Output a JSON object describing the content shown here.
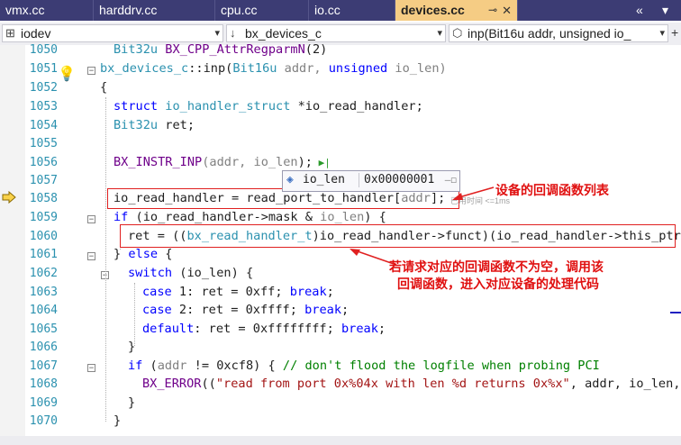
{
  "tabs": [
    {
      "label": "vmx.cc",
      "active": false
    },
    {
      "label": "harddrv.cc",
      "active": false
    },
    {
      "label": "cpu.cc",
      "active": false
    },
    {
      "label": "io.cc",
      "active": false
    },
    {
      "label": "devices.cc",
      "active": true
    }
  ],
  "tab_pin_glyph": "⊸",
  "tab_close_glyph": "✕",
  "tab_controls": {
    "overflow": "«",
    "menu": "▾"
  },
  "nav": {
    "project": "iodev",
    "scope": "bx_devices_c",
    "member": "inp(Bit16u addr, unsigned io_"
  },
  "lines": [
    {
      "n": "1050"
    },
    {
      "n": "1051"
    },
    {
      "n": "1052"
    },
    {
      "n": "1053"
    },
    {
      "n": "1054"
    },
    {
      "n": "1055"
    },
    {
      "n": "1056"
    },
    {
      "n": "1057"
    },
    {
      "n": "1058"
    },
    {
      "n": "1059"
    },
    {
      "n": "1060"
    },
    {
      "n": "1061"
    },
    {
      "n": "1062"
    },
    {
      "n": "1063"
    },
    {
      "n": "1064"
    },
    {
      "n": "1065"
    },
    {
      "n": "1066"
    },
    {
      "n": "1067"
    },
    {
      "n": "1068"
    },
    {
      "n": "1069"
    },
    {
      "n": "1070"
    }
  ],
  "code": {
    "l1050": {
      "ty": "Bit32u",
      "mac": "BX_CPP_AttrRegparmN",
      "rest": "(2)"
    },
    "l1051": {
      "cls": "bx_devices_c",
      "sep": "::",
      "fn": "inp(",
      "t1": "Bit16u",
      "p1": " addr, ",
      "kw": "unsigned",
      "p2": " io_len)"
    },
    "l1052": "{",
    "l1053": {
      "kw": "struct",
      "ty": " io_handler_struct",
      "rest": " *io_read_handler;"
    },
    "l1054": {
      "ty": "Bit32u",
      "rest": " ret;"
    },
    "l1056": {
      "mac": "BX_INSTR_INP",
      "a": "(addr, ",
      "b": "io_len",
      "c": ");",
      "run": " ▶|"
    },
    "l1058": {
      "a": "io_read_handler = read_port_to_handler[",
      "b": "addr",
      "c": "];"
    },
    "l1059": {
      "kw": "if",
      "a": " (io_read_handler->mask & ",
      "b": "io_len",
      "c": ") {"
    },
    "l1060": {
      "a": "ret = ((",
      "ty": "bx_read_handler_t",
      "b": ")io_read_handler->funct)(io_read_handler->this_ptr"
    },
    "l1061": {
      "a": "} ",
      "kw": "else",
      "b": " {"
    },
    "l1062": {
      "kw": "switch",
      "a": " (io_len) {"
    },
    "l1063": {
      "kw": "case",
      "a": " 1: ret = 0xff; ",
      "kw2": "break",
      "b": ";"
    },
    "l1064": {
      "kw": "case",
      "a": " 2: ret = 0xffff; ",
      "kw2": "break",
      "b": ";"
    },
    "l1065": {
      "kw": "default",
      "a": ": ret = 0xffffffff; ",
      "kw2": "break",
      "b": ";"
    },
    "l1066": "}",
    "l1067": {
      "kw": "if",
      "a": " (",
      "p": "addr",
      "b": " != 0xcf8) { ",
      "cmt": "// don't flood the logfile when probing PCI"
    },
    "l1068": {
      "mac": "BX_ERROR",
      "a": "((",
      "str": "\"read from port 0x%04x with len %d returns 0x%x\"",
      "b": ", addr, io_len,"
    },
    "l1069": "}",
    "l1070": "}"
  },
  "datatip": {
    "name": "io_len",
    "value": "0x00000001"
  },
  "elapsed_hint": "已用时间 <=1ms",
  "annotations": {
    "table": "设备的回调函数列表",
    "callback_line1": "若请求对应的回调函数不为空，调用该",
    "callback_line2": "回调函数，进入对应设备的处理代码"
  },
  "colors": {
    "annotation": "#e02020",
    "tab_active": "#f5cc84",
    "tab_bar": "#3c3c74"
  }
}
